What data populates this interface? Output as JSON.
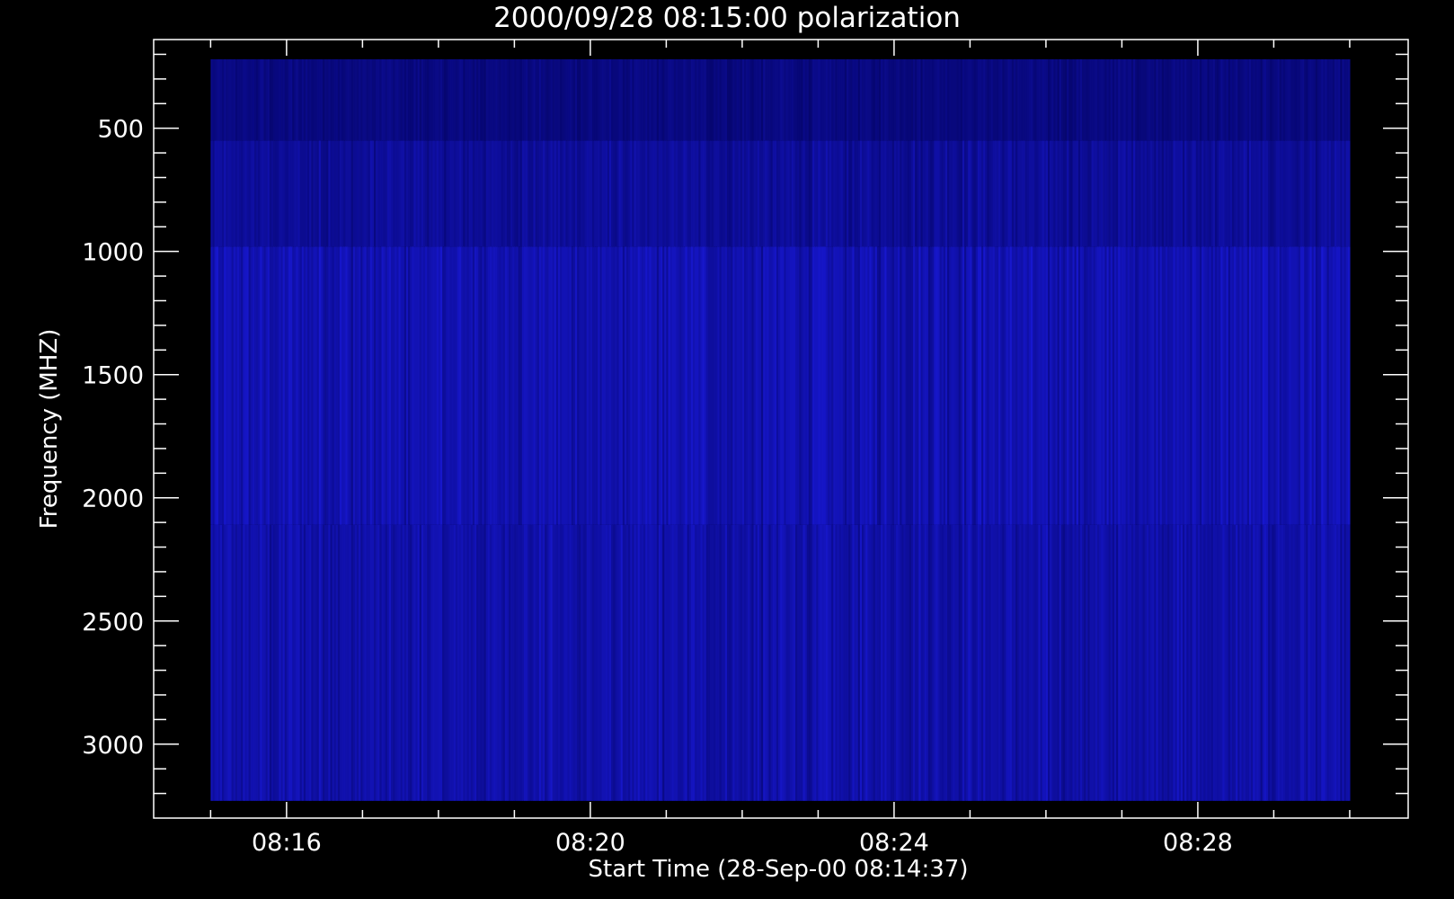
{
  "chart_data": {
    "type": "heatmap",
    "title": "2000/09/28 08:15:00 polarization",
    "xlabel": "Start Time (28-Sep-00 08:14:37)",
    "ylabel": "Frequency (MHZ)",
    "x_ticks": [
      "08:16",
      "08:20",
      "08:24",
      "08:28"
    ],
    "x_tick_minutes": [
      16,
      20,
      24,
      28
    ],
    "x_axis_range_minutes": [
      14.25,
      30.77
    ],
    "y_ticks": [
      500,
      1000,
      1500,
      2000,
      2500,
      3000
    ],
    "y_axis_range": [
      3300,
      140
    ],
    "y_reversed": true,
    "data_time_range_minutes": [
      15.0,
      30.0
    ],
    "data_frequency_range": [
      220,
      3230
    ],
    "frequency_bands": [
      {
        "from": 220,
        "to": 550,
        "level": 0.3
      },
      {
        "from": 550,
        "to": 980,
        "level": 0.45
      },
      {
        "from": 980,
        "to": 2110,
        "level": 0.6
      },
      {
        "from": 2110,
        "to": 3230,
        "level": 0.55
      }
    ],
    "colormap": {
      "low": "#000050",
      "high": "#2020ff"
    },
    "background": "#000000",
    "foreground": "#ffffff"
  }
}
